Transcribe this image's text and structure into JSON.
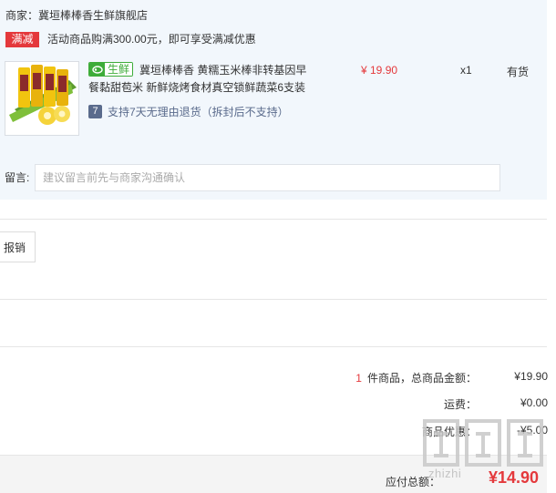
{
  "order": {
    "seller": "商家：冀垣棒棒香生鲜旗舰店",
    "promo_badge": "满减",
    "promo_text": "活动商品购满300.00元，即可享受满减优惠",
    "item": {
      "fresh_tag": "生鲜",
      "title": "冀垣棒棒香 黄糯玉米棒非转基因早餐黏甜苞米 新鲜烧烤食材真空锁鲜蔬菜6支装",
      "price": "¥ 19.90",
      "quantity": "x1",
      "stock": "有货",
      "return_icon": "7",
      "return_policy": "支持7天无理由退货（拆封后不支持）"
    },
    "message": {
      "label": "留言:",
      "placeholder": "建议留言前先与商家沟通确认",
      "value": ""
    }
  },
  "invoice": {
    "button_label": "报销"
  },
  "summary": {
    "count": "1",
    "goods_label": "件商品，总商品金额：",
    "goods_value": "¥19.90",
    "shipping_label": "运费：",
    "shipping_value": "¥0.00",
    "discount_label": "商品优惠：",
    "discount_value": "-¥5.00"
  },
  "payment": {
    "label": "应付总额：",
    "value": "¥14.90"
  },
  "watermark": {
    "text": "zhizhi"
  },
  "colors": {
    "accent": "#e4393c",
    "fresh": "#3dac39",
    "panel": "#f2f7fc"
  },
  "icons": [
    "fresh-food-icon",
    "return-policy-icon"
  ]
}
